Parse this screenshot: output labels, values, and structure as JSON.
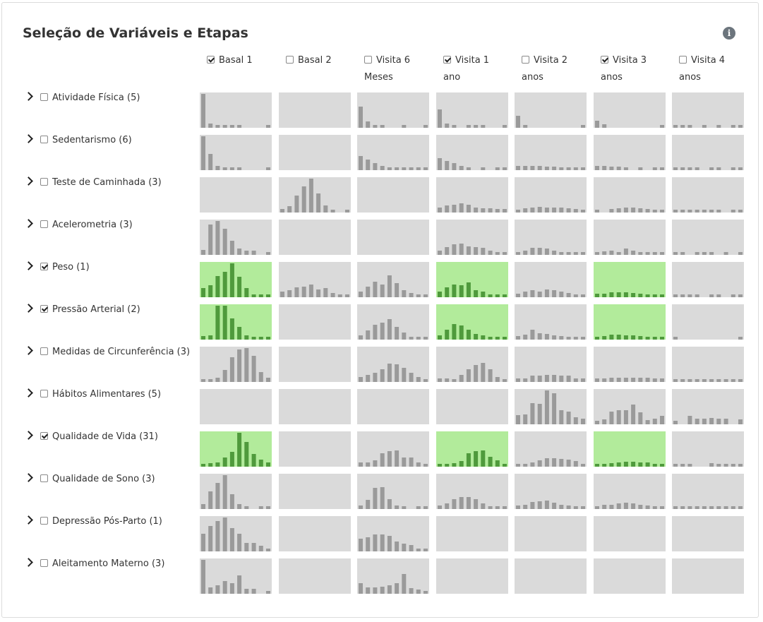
{
  "title": "Seleção de Variáveis e Etapas",
  "icons": {
    "info": "info-icon",
    "expand": "chevron-right-icon",
    "checkbox": "checkbox-icon"
  },
  "colors": {
    "cell_bg": "#dadada",
    "cell_selected_bg": "#b2eb9b",
    "bar": "#9a9a9a",
    "bar_selected": "#4f9a3c"
  },
  "columns": [
    {
      "line1": "Basal 1",
      "line2": "",
      "checked": true
    },
    {
      "line1": "Basal 2",
      "line2": "",
      "checked": false
    },
    {
      "line1": "Visita 6",
      "line2": "Meses",
      "checked": false
    },
    {
      "line1": "Visita 1",
      "line2": "ano",
      "checked": true
    },
    {
      "line1": "Visita 2",
      "line2": "anos",
      "checked": false
    },
    {
      "line1": "Visita 3",
      "line2": "anos",
      "checked": true
    },
    {
      "line1": "Visita 4",
      "line2": "anos",
      "checked": false
    }
  ],
  "rows": [
    {
      "label": "Atividade Física (5)",
      "checked": false,
      "cells": [
        [
          1.0,
          0.12,
          0.08,
          0.08,
          0.08,
          0.08,
          0,
          0,
          0,
          0.08
        ],
        [],
        [
          0.62,
          0.18,
          0.08,
          0.08,
          0,
          0,
          0.08,
          0,
          0,
          0.08
        ],
        [
          0.55,
          0.12,
          0.08,
          0,
          0.08,
          0.08,
          0.08,
          0,
          0,
          0.08
        ],
        [
          0.35,
          0.08,
          0,
          0,
          0,
          0,
          0,
          0,
          0,
          0.08
        ],
        [
          0.2,
          0.1,
          0,
          0,
          0,
          0,
          0,
          0,
          0,
          0.08
        ],
        [
          0.08,
          0.08,
          0.08,
          0,
          0.08,
          0,
          0.08,
          0,
          0.08,
          0.08
        ]
      ]
    },
    {
      "label": "Sedentarismo (6)",
      "checked": false,
      "cells": [
        [
          1.0,
          0.48,
          0.12,
          0.08,
          0.08,
          0.08,
          0,
          0,
          0,
          0.08
        ],
        [],
        [
          0.42,
          0.32,
          0.2,
          0.12,
          0.08,
          0.08,
          0.08,
          0.08,
          0.08,
          0.08
        ],
        [
          0.36,
          0.28,
          0.2,
          0.12,
          0.08,
          0,
          0.08,
          0,
          0.08,
          0.08
        ],
        [
          0.12,
          0.12,
          0.12,
          0.12,
          0.1,
          0.1,
          0.08,
          0.08,
          0.08,
          0.08
        ],
        [
          0.12,
          0.12,
          0.1,
          0.1,
          0.08,
          0,
          0.08,
          0,
          0.08,
          0.08
        ],
        [
          0.08,
          0.08,
          0.08,
          0.08,
          0,
          0.08,
          0.08,
          0,
          0.08,
          0.08
        ]
      ]
    },
    {
      "label": "Teste de Caminhada (3)",
      "checked": false,
      "cells": [
        [],
        [
          0.1,
          0.18,
          0.5,
          0.78,
          1.0,
          0.56,
          0.2,
          0.08,
          0,
          0.08
        ],
        [],
        [
          0.15,
          0.2,
          0.22,
          0.28,
          0.22,
          0.15,
          0.12,
          0.12,
          0.1,
          0.1
        ],
        [
          0.08,
          0.12,
          0.14,
          0.16,
          0.14,
          0.14,
          0.14,
          0.12,
          0.1,
          0.08
        ],
        [
          0.08,
          0,
          0.1,
          0.12,
          0.14,
          0.14,
          0.12,
          0.1,
          0.08,
          0.08
        ],
        [
          0.08,
          0.08,
          0.08,
          0.08,
          0.08,
          0.08,
          0.08,
          0,
          0.08,
          0.08
        ]
      ]
    },
    {
      "label": "Acelerometria (3)",
      "checked": false,
      "cells": [
        [
          0.15,
          0.9,
          1.0,
          0.78,
          0.42,
          0.18,
          0.12,
          0.12,
          0,
          0.08
        ],
        [],
        [],
        [
          0.12,
          0.22,
          0.32,
          0.34,
          0.26,
          0.22,
          0.2,
          0.12,
          0.08,
          0.08
        ],
        [
          0.08,
          0.12,
          0.2,
          0.2,
          0.18,
          0.12,
          0.08,
          0.08,
          0.08,
          0.08
        ],
        [
          0.08,
          0.1,
          0.12,
          0.08,
          0.18,
          0.12,
          0.08,
          0.08,
          0.08,
          0.08
        ],
        [
          0.08,
          0.08,
          0,
          0.08,
          0.08,
          0.08,
          0,
          0.08,
          0,
          0.08
        ]
      ]
    },
    {
      "label": "Peso (1)",
      "checked": true,
      "cells": [
        [
          0.28,
          0.36,
          0.62,
          0.76,
          1.0,
          0.6,
          0.28,
          0.08,
          0.08,
          0.08
        ],
        [
          0.16,
          0.2,
          0.3,
          0.32,
          0.38,
          0.22,
          0.28,
          0.12,
          0.08,
          0.08
        ],
        [
          0.16,
          0.32,
          0.46,
          0.38,
          0.64,
          0.42,
          0.2,
          0.12,
          0.08,
          0.08
        ],
        [
          0.16,
          0.3,
          0.38,
          0.36,
          0.44,
          0.2,
          0.16,
          0.08,
          0.08,
          0.08
        ],
        [
          0.1,
          0.16,
          0.2,
          0.16,
          0.22,
          0.2,
          0.16,
          0.12,
          0.08,
          0.08
        ],
        [
          0.1,
          0.1,
          0.14,
          0.14,
          0.14,
          0.12,
          0.1,
          0.08,
          0.08,
          0.08
        ],
        [
          0.08,
          0.08,
          0.08,
          0.08,
          0,
          0.08,
          0.08,
          0,
          0.08,
          0.08
        ]
      ]
    },
    {
      "label": "Pressão Arterial (2)",
      "checked": true,
      "cells": [
        [
          0.1,
          0.12,
          1.0,
          1.0,
          0.62,
          0.38,
          0.12,
          0.08,
          0.08,
          0.08
        ],
        [],
        [
          0.12,
          0.28,
          0.44,
          0.5,
          0.6,
          0.38,
          0.2,
          0.08,
          0.08,
          0.08
        ],
        [
          0.12,
          0.3,
          0.46,
          0.42,
          0.3,
          0.16,
          0.12,
          0.08,
          0.08,
          0.08
        ],
        [
          0.1,
          0.14,
          0.3,
          0.18,
          0.16,
          0.12,
          0.1,
          0.08,
          0.08,
          0.08
        ],
        [
          0.08,
          0.1,
          0.14,
          0.14,
          0.12,
          0.12,
          0.1,
          0.08,
          0.08,
          0.08
        ],
        [
          0.08,
          0,
          0,
          0,
          0,
          0,
          0,
          0,
          0,
          0.08
        ]
      ]
    },
    {
      "label": "Medidas de Circunferência (3)",
      "checked": false,
      "cells": [
        [
          0.08,
          0.08,
          0.12,
          0.36,
          0.72,
          0.96,
          1.0,
          0.78,
          0.3,
          0.12
        ],
        [],
        [
          0.14,
          0.2,
          0.28,
          0.38,
          0.54,
          0.52,
          0.42,
          0.28,
          0.14,
          0.08
        ],
        [
          0.1,
          0.1,
          0.08,
          0.2,
          0.38,
          0.5,
          0.56,
          0.38,
          0.14,
          0.08
        ],
        [
          0.1,
          0.1,
          0.18,
          0.18,
          0.2,
          0.2,
          0.18,
          0.18,
          0.1,
          0.1
        ],
        [
          0.1,
          0.1,
          0.12,
          0.12,
          0.12,
          0.12,
          0.12,
          0.12,
          0.1,
          0.1
        ],
        [
          0.08,
          0.08,
          0.08,
          0.08,
          0.08,
          0.08,
          0.08,
          0.08,
          0.08,
          0.08
        ]
      ]
    },
    {
      "label": "Hábitos Alimentares (5)",
      "checked": false,
      "cells": [
        [],
        [],
        [],
        [],
        [
          0.28,
          0.3,
          0.62,
          0.6,
          1.0,
          0.92,
          0.42,
          0.38,
          0.2,
          0.16
        ],
        [
          0.1,
          0.14,
          0.38,
          0.42,
          0.42,
          0.58,
          0.36,
          0.12,
          0.16,
          0.24
        ],
        [
          0.1,
          0,
          0.26,
          0.16,
          0.16,
          0.18,
          0.16,
          0.16,
          0,
          0.14
        ]
      ]
    },
    {
      "label": "Qualidade de Vida (31)",
      "checked": true,
      "cells": [
        [
          0.08,
          0.1,
          0.12,
          0.28,
          0.44,
          1.0,
          0.72,
          0.38,
          0.2,
          0.12
        ],
        [],
        [
          0.12,
          0.12,
          0.18,
          0.4,
          0.46,
          0.48,
          0.28,
          0.28,
          0.12,
          0.08
        ],
        [
          0.08,
          0.08,
          0.1,
          0.16,
          0.4,
          0.46,
          0.48,
          0.3,
          0.18,
          0.08
        ],
        [
          0.08,
          0.08,
          0.12,
          0.18,
          0.26,
          0.26,
          0.22,
          0.2,
          0.16,
          0.08
        ],
        [
          0.08,
          0.08,
          0.1,
          0.12,
          0.14,
          0.14,
          0.12,
          0.12,
          0.08,
          0.08
        ],
        [
          0.08,
          0.08,
          0.08,
          0,
          0,
          0.1,
          0.08,
          0.08,
          0.08,
          0.08
        ]
      ]
    },
    {
      "label": "Qualidade de Sono (3)",
      "checked": false,
      "cells": [
        [
          0.14,
          0.52,
          0.78,
          1.0,
          0.44,
          0.14,
          0.08,
          0,
          0.08,
          0.08
        ],
        [],
        [
          0.1,
          0.28,
          0.62,
          0.64,
          0.3,
          0.1,
          0.08,
          0,
          0.08,
          0.08
        ],
        [
          0.1,
          0.16,
          0.3,
          0.36,
          0.36,
          0.3,
          0.16,
          0.08,
          0.08,
          0.08
        ],
        [
          0.1,
          0.12,
          0.2,
          0.22,
          0.24,
          0.18,
          0.12,
          0.1,
          0.08,
          0.08
        ],
        [
          0.08,
          0.12,
          0.12,
          0.16,
          0.18,
          0.16,
          0.12,
          0.1,
          0.08,
          0.08
        ],
        [
          0.08,
          0.08,
          0.08,
          0.08,
          0.08,
          0.08,
          0.08,
          0.08,
          0.08,
          0.08
        ]
      ]
    },
    {
      "label": "Depressão Pós-Parto (1)",
      "checked": false,
      "cells": [
        [
          0.52,
          0.74,
          0.9,
          1.0,
          0.68,
          0.52,
          0.24,
          0.24,
          0.16,
          0.08
        ],
        [],
        [
          0.38,
          0.42,
          0.5,
          0.5,
          0.46,
          0.3,
          0.22,
          0.18,
          0.08,
          0.08
        ],
        [],
        [],
        [],
        []
      ]
    },
    {
      "label": "Aleitamento Materno (3)",
      "checked": false,
      "cells": [
        [
          1.0,
          0.18,
          0.24,
          0.38,
          0.32,
          0.54,
          0.14,
          0.14,
          0,
          0.08
        ],
        [],
        [
          0.32,
          0.18,
          0.18,
          0.2,
          0.24,
          0.32,
          0.58,
          0.16,
          0.12,
          0.08
        ],
        [],
        [],
        [],
        []
      ]
    }
  ]
}
